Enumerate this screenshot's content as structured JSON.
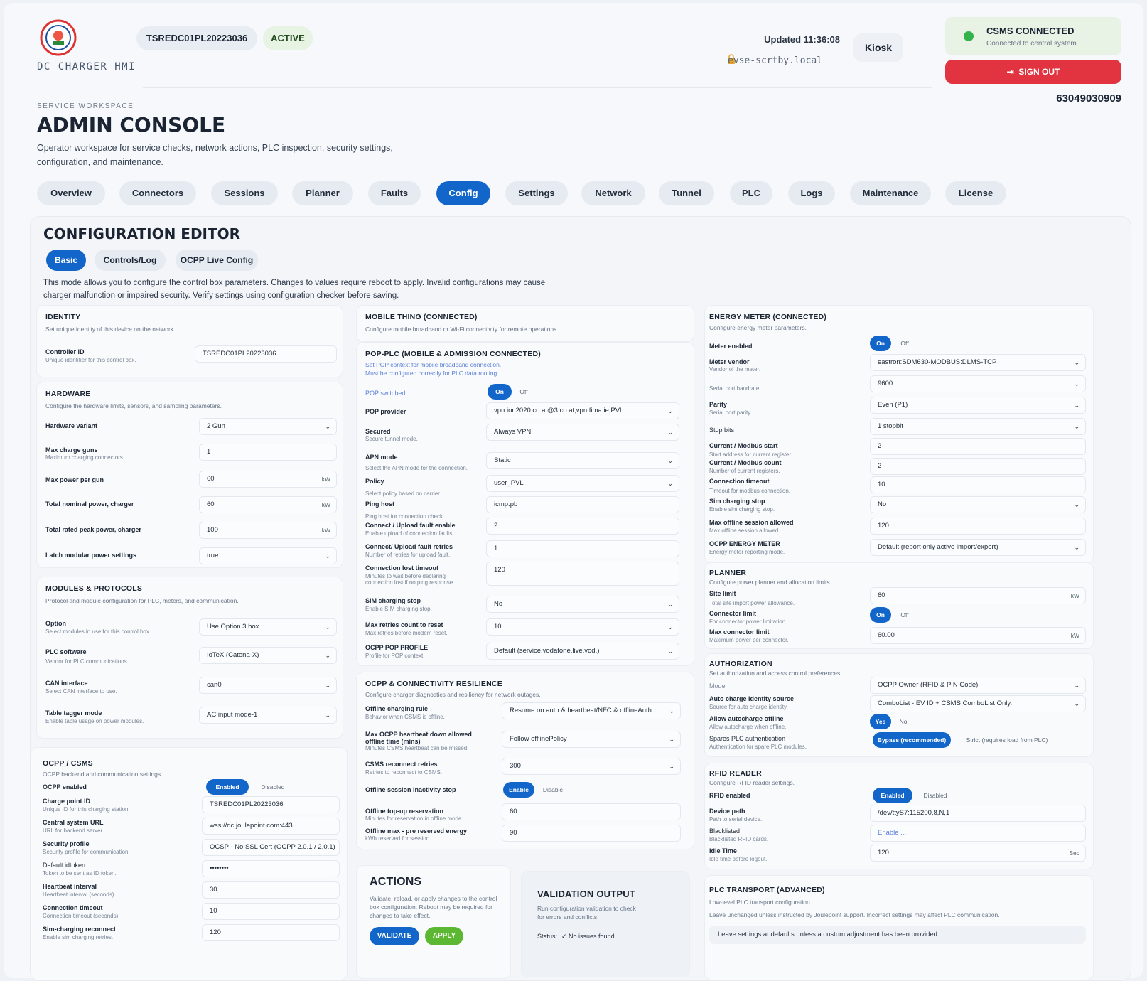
{
  "header": {
    "brand": "DC CHARGER HMI",
    "charger_id": "TSREDC01PL20223036",
    "status": "ACTIVE",
    "updated": "Updated 11:36:08",
    "host": "evse-scrtby.local",
    "kiosk": "Kiosk",
    "csms_title": "CSMS CONNECTED",
    "csms_sub": "Connected to central system",
    "sign_out": "SIGN OUT",
    "serial": "63049030909",
    "colors": {
      "accent": "#1266c9",
      "danger": "#e23440",
      "ok": "#33b34a",
      "apply": "#5cb832"
    }
  },
  "page": {
    "eyebrow": "SERVICE WORKSPACE",
    "title": "ADMIN CONSOLE",
    "description": "Operator workspace for service checks, network actions, PLC inspection, security settings, configuration, and maintenance."
  },
  "tabs": [
    "Overview",
    "Connectors",
    "Sessions",
    "Planner",
    "Faults",
    "Config",
    "Settings",
    "Network",
    "Tunnel",
    "PLC",
    "Logs",
    "Maintenance",
    "License"
  ],
  "active_tab": "Config",
  "editor": {
    "title": "CONFIGURATION EDITOR",
    "subtabs": [
      "Basic",
      "Controls/Log",
      "OCPP Live Config"
    ],
    "note": "This mode allows you to configure the control box parameters. Changes to values require reboot to apply. Invalid configurations may cause charger malfunction or impaired security. Verify settings using configuration checker before saving."
  },
  "identity": {
    "title": "IDENTITY",
    "sub": "Set unique identity of this device on the network.",
    "fields": [
      {
        "label": "Controller ID",
        "sub": "Unique identifier for this control box.",
        "value": "TSREDC01PL20223036"
      }
    ]
  },
  "hardware": {
    "title": "HARDWARE",
    "sub": "Configure the hardware limits, sensors, and sampling parameters.",
    "fields": [
      {
        "label": "Hardware variant",
        "sub": "",
        "value": "2 Gun",
        "unit": "⌄"
      },
      {
        "label": "Max charge guns",
        "sub": "Maximum charging connectors.",
        "value": "1",
        "unit": ""
      },
      {
        "label": "Max power per gun",
        "sub": "",
        "value": "60",
        "unit": "kW"
      },
      {
        "label": "Total nominal power, charger",
        "sub": "",
        "value": "60",
        "unit": "kW"
      },
      {
        "label": "Total rated peak power, charger",
        "sub": "",
        "value": "100",
        "unit": "kW"
      },
      {
        "label": "Latch modular power settings",
        "sub": "",
        "value": "true",
        "unit": "⌄"
      }
    ]
  },
  "modules": {
    "title": "MODULES & PROTOCOLS",
    "sub": "Protocol and module configuration for PLC, meters, and communication.",
    "fields": [
      {
        "label": "Option",
        "sub": "Select modules in use for this control box.",
        "value": "Use Option 3 box"
      },
      {
        "label": "PLC software",
        "sub": "Vendor for PLC communications.",
        "value": "IoTeX (Catena-X)"
      },
      {
        "label": "CAN interface",
        "sub": "Select CAN interface to use.",
        "value": "can0"
      },
      {
        "label": "Table tagger mode",
        "sub": "Enable table usage on power modules.",
        "value": "AC input mode-1"
      }
    ]
  },
  "ocpp": {
    "title": "OCPP / CSMS",
    "sub": "OCPP backend and communication settings.",
    "enabled_label": "OCPP enabled",
    "on": "Enabled",
    "off": "Disabled",
    "fields": [
      {
        "label": "Charge point ID",
        "sub": "Unique ID for this charging station.",
        "value": "TSREDC01PL20223036"
      },
      {
        "label": "Central system URL",
        "sub": "URL for backend server.",
        "value": "wss://dc.joulepoint.com:443"
      },
      {
        "label": "Security profile",
        "sub": "Security profile for communication.",
        "value": "OCSP - No SSL Cert (OCPP 2.0.1 / 2.0.1)"
      },
      {
        "label": "Default idtoken",
        "sub": "Token to be sent as ID token.",
        "value": "••••••••"
      },
      {
        "label": "Heartbeat interval",
        "sub": "Heartbeat interval (seconds).",
        "value": "30"
      },
      {
        "label": "Connection timeout",
        "sub": "Connection timeout (seconds).",
        "value": "10"
      },
      {
        "label": "Sim-charging reconnect",
        "sub": "Enable sim charging retries.",
        "value": "120"
      }
    ]
  },
  "mobile": {
    "title": "MOBILE THING (CONNECTED)",
    "sub": "Configure mobile broadband or Wi-Fi connectivity for remote operations."
  },
  "pop": {
    "title": "POP-PLC (MOBILE & ADMISSION CONNECTED)",
    "sub1": "Set POP context for mobile broadband connection.",
    "sub2": "Must be configured correctly for PLC data routing.",
    "switch_label": "POP switched",
    "on": "On",
    "off": "Off",
    "fields": [
      {
        "label": "POP provider",
        "sub": "",
        "value": "vpn.ion2020.co.at@3.co.at;vpn.fima.ie;PVL",
        "sel": true
      },
      {
        "label": "Secured",
        "sub": "Secure tunnel mode.",
        "value": "Always VPN",
        "sel": true
      },
      {
        "label": "APN mode",
        "sub": "Select the APN mode for the connection.",
        "value": "Static",
        "sel": true
      },
      {
        "label": "Policy",
        "sub": "Select policy based on carrier.",
        "value": "user_PVL",
        "sel": true
      },
      {
        "label": "Ping host",
        "sub": "Ping host for connection check.",
        "value": "icmp.pb",
        "sel": false
      },
      {
        "label": "Connect / Upload fault enable",
        "sub": "Enable upload of connection faults.",
        "value": "2",
        "sel": false
      },
      {
        "label": "Connect/ Upload fault retries",
        "sub": "Number of retries for upload fault.",
        "value": "1",
        "sel": false
      },
      {
        "label": "Connection lost timeout",
        "sub": "Minutes to wait before declaring connection lost if no ping response.",
        "value": "120",
        "sel": false
      },
      {
        "label": "SIM charging stop",
        "sub": "Enable SIM charging stop.",
        "value": "No",
        "sel": true
      },
      {
        "label": "Max retries count to reset",
        "sub": "Max retries before modem reset.",
        "value": "10",
        "sel": true
      },
      {
        "label": "OCPP POP PROFILE",
        "sub": "Profile for POP context.",
        "value": "Default (service.vodafone.live.vod.)",
        "sel": true
      }
    ]
  },
  "resilience": {
    "title": "OCPP & CONNECTIVITY RESILIENCE",
    "sub": "Configure charger diagnostics and resiliency for network outages.",
    "fields": [
      {
        "label": "Offline charging rule",
        "sub": "Behavior when CSMS is offline.",
        "value": "Resume on auth & heartbeat/NFC & offlineAuth"
      },
      {
        "label": "Max OCPP heartbeat down allowed offline time (mins)",
        "sub": "Minutes CSMS heartbeat can be missed.",
        "value": "Follow offlinePolicy"
      },
      {
        "label": "CSMS reconnect retries",
        "sub": "Retries to reconnect to CSMS.",
        "value": "300"
      }
    ],
    "inactivity_label": "Offline session inactivity stop",
    "enable": "Enable",
    "disable": "Disable",
    "topup_label": "Offline top-up reservation",
    "topup_sub": "Minutes for reservation in offline mode.",
    "topup_value": "60",
    "maxres_label": "Offline max - pre reserved energy",
    "maxres_sub": "kWh reserved for session.",
    "maxres_value": "90"
  },
  "actions": {
    "title": "ACTIONS",
    "desc": "Validate, reload, or apply changes to the control box configuration. Reboot may be required for changes to take effect.",
    "validate": "VALIDATE",
    "apply": "APPLY"
  },
  "validation": {
    "title": "VALIDATION OUTPUT",
    "desc": "Run configuration validation to check for errors and conflicts.",
    "status_label": "Status:",
    "status_value": "✓  No issues found"
  },
  "energy": {
    "title": "ENERGY METER (CONNECTED)",
    "sub": "Configure energy meter parameters.",
    "enabled_label": "Meter enabled",
    "on": "On",
    "off": "Off",
    "fields": [
      {
        "label": "Meter vendor",
        "sub": "Vendor of the meter.",
        "value": "eastron:SDM630-MODBUS:DLMS-TCP",
        "sel": true
      },
      {
        "label": "",
        "sub": "Serial port baudrate.",
        "value": "9600",
        "sel": true
      },
      {
        "label": "Parity",
        "sub": "Serial port parity.",
        "value": "Even (P1)",
        "sel": true
      },
      {
        "label": "Stop bits",
        "sub": "",
        "value": "1 stopbit",
        "sel": true
      },
      {
        "label": "Current / Modbus start",
        "sub": "Start address for current register.",
        "value": "2",
        "sel": false
      },
      {
        "label": "Current / Modbus count",
        "sub": "Number of current registers.",
        "value": "2",
        "sel": false
      },
      {
        "label": "Connection timeout",
        "sub": "Timeout for modbus connection.",
        "value": "10",
        "sel": false
      },
      {
        "label": "Sim charging stop",
        "sub": "Enable sim charging stop.",
        "value": "No",
        "sel": true
      },
      {
        "label": "Max offline session allowed",
        "sub": "Max offline session allowed.",
        "value": "120",
        "sel": false
      },
      {
        "label": "OCPP ENERGY METER",
        "sub": "Energy meter reporting mode.",
        "value": "Default (report only active import/export)",
        "sel": true
      }
    ]
  },
  "planner": {
    "title": "PLANNER",
    "sub": "Configure power planner and allocation limits.",
    "site_label": "Site limit",
    "site_sub": "Total site import power allowance.",
    "site_value": "60",
    "unit": "kW",
    "conn_label": "Connector limit",
    "conn_sub": "For connector power limitation.",
    "on": "On",
    "off": "Off",
    "max_label": "Max connector limit",
    "max_sub": "Maximum power per connector.",
    "max_value": "60.00"
  },
  "auth": {
    "title": "AUTHORIZATION",
    "sub": "Set authorization and access control preferences.",
    "mode_label": "Mode",
    "mode_value": "OCPP Owner (RFID & PIN Code)",
    "auto_label": "Auto charge identity source",
    "auto_sub": "Source for auto charge identity.",
    "auto_value": "ComboList - EV ID + CSMS ComboList Only.",
    "allow_label": "Allow autocharge offline",
    "allow_sub": "Allow autocharge when offline.",
    "yes": "Yes",
    "no": "No",
    "spare_label": "Spares PLC authentication",
    "spare_sub": "Authentication for spare PLC modules.",
    "bypass": "Bypass (recommended)",
    "strict": "Strict (requires load from PLC)"
  },
  "rfid": {
    "title": "RFID READER",
    "sub": "Configure RFID reader settings.",
    "enabled_label": "RFID enabled",
    "on": "Enabled",
    "off": "Disabled",
    "device_label": "Device path",
    "device_sub": "Path to serial device.",
    "device_value": "/dev/ttyS7:115200,8,N,1",
    "black_label": "Blacklisted",
    "black_sub": "Blacklisted RFID cards.",
    "black_value": "Enable ...",
    "idle_label": "Idle Time",
    "idle_sub": "Idle time before logout.",
    "idle_value": "120",
    "idle_unit": "Sec"
  },
  "plc": {
    "title": "PLC TRANSPORT (ADVANCED)",
    "sub": "Low-level PLC transport configuration.",
    "warn": "Leave unchanged unless instructed by Joulepoint support. Incorrect settings may affect PLC communication.",
    "note": "Leave settings at defaults unless a custom adjustment has been provided."
  }
}
